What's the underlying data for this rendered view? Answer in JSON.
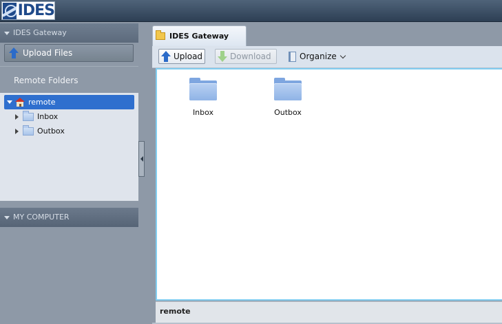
{
  "header": {
    "logo_text": "IDES"
  },
  "sidebar": {
    "gateway_header": "IDES Gateway",
    "upload_files_label": "Upload Files",
    "remote_folders_title": "Remote Folders",
    "tree": {
      "root": "remote",
      "children": [
        "Inbox",
        "Outbox"
      ]
    },
    "my_computer_header": "MY COMPUTER"
  },
  "main": {
    "tab_label": "IDES Gateway",
    "toolbar": {
      "upload_label": "Upload",
      "download_label": "Download",
      "organize_label": "Organize"
    },
    "items": [
      {
        "label": "Inbox"
      },
      {
        "label": "Outbox"
      }
    ],
    "status_path": "remote"
  },
  "colors": {
    "selection": "#2f6fce",
    "content_border": "#82cdf0",
    "folder_blue": "#8fb3e6"
  }
}
